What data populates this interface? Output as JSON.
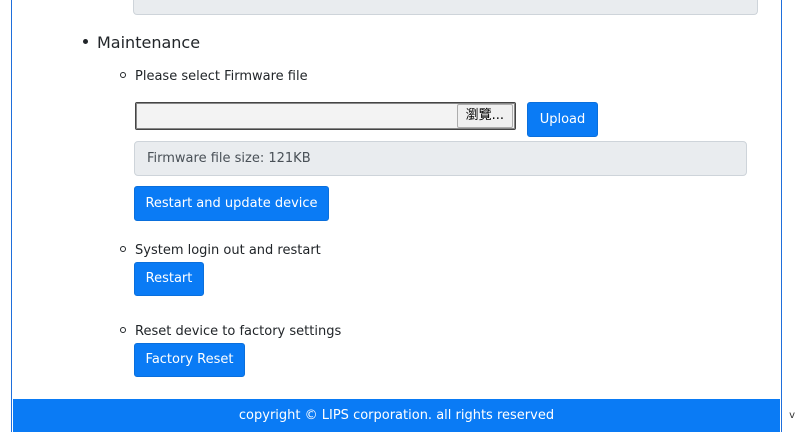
{
  "maintenance": {
    "title": "Maintenance",
    "firmware_label": "Please select Firmware file",
    "file_input": {
      "value": "",
      "browse_label": "瀏覽..."
    },
    "upload_label": "Upload",
    "firmware_size_text": "Firmware file size: 121KB",
    "restart_update_label": "Restart and update device",
    "system_restart_label": "System login out and restart",
    "restart_label": "Restart",
    "factory_label": "Reset device to factory settings",
    "factory_reset_label": "Factory Reset"
  },
  "footer": {
    "text": "copyright © LIPS corporation. all rights reserved"
  },
  "colors": {
    "accent": "#0a7bf5",
    "readonly_bg": "#e9ecef"
  }
}
